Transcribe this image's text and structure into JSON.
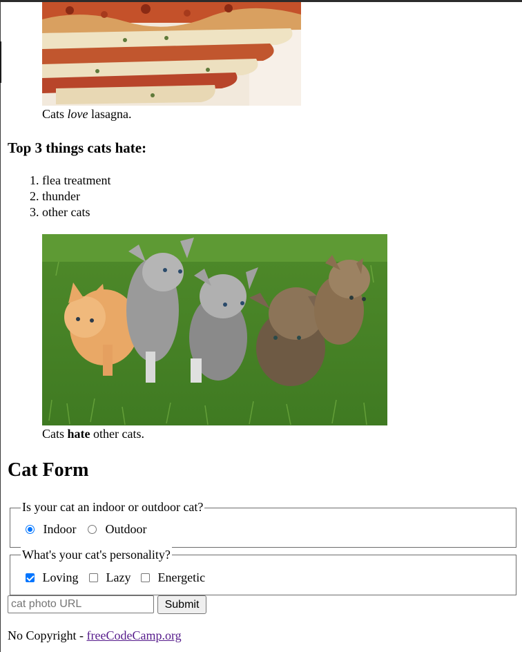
{
  "lasagna_caption": {
    "prefix": "Cats ",
    "emphasis": "love",
    "suffix": " lasagna."
  },
  "hate_heading": "Top 3 things cats hate:",
  "hate_list": [
    "flea treatment",
    "thunder",
    "other cats"
  ],
  "cats_caption": {
    "prefix": "Cats ",
    "strong": "hate",
    "suffix": " other cats."
  },
  "form_heading": "Cat Form",
  "location_fieldset": {
    "legend": "Is your cat an indoor or outdoor cat?",
    "options": [
      {
        "label": "Indoor",
        "checked": true
      },
      {
        "label": "Outdoor",
        "checked": false
      }
    ]
  },
  "personality_fieldset": {
    "legend": "What's your cat's personality?",
    "options": [
      {
        "label": "Loving",
        "checked": true
      },
      {
        "label": "Lazy",
        "checked": false
      },
      {
        "label": "Energetic",
        "checked": false
      }
    ]
  },
  "photo_url": {
    "placeholder": "cat photo URL",
    "value": ""
  },
  "submit_label": "Submit",
  "footer": {
    "prefix": "No Copyright - ",
    "link_text": "freeCodeCamp.org"
  },
  "colors": {
    "accent": "#0075ff",
    "visited_link": "#551a8b"
  }
}
